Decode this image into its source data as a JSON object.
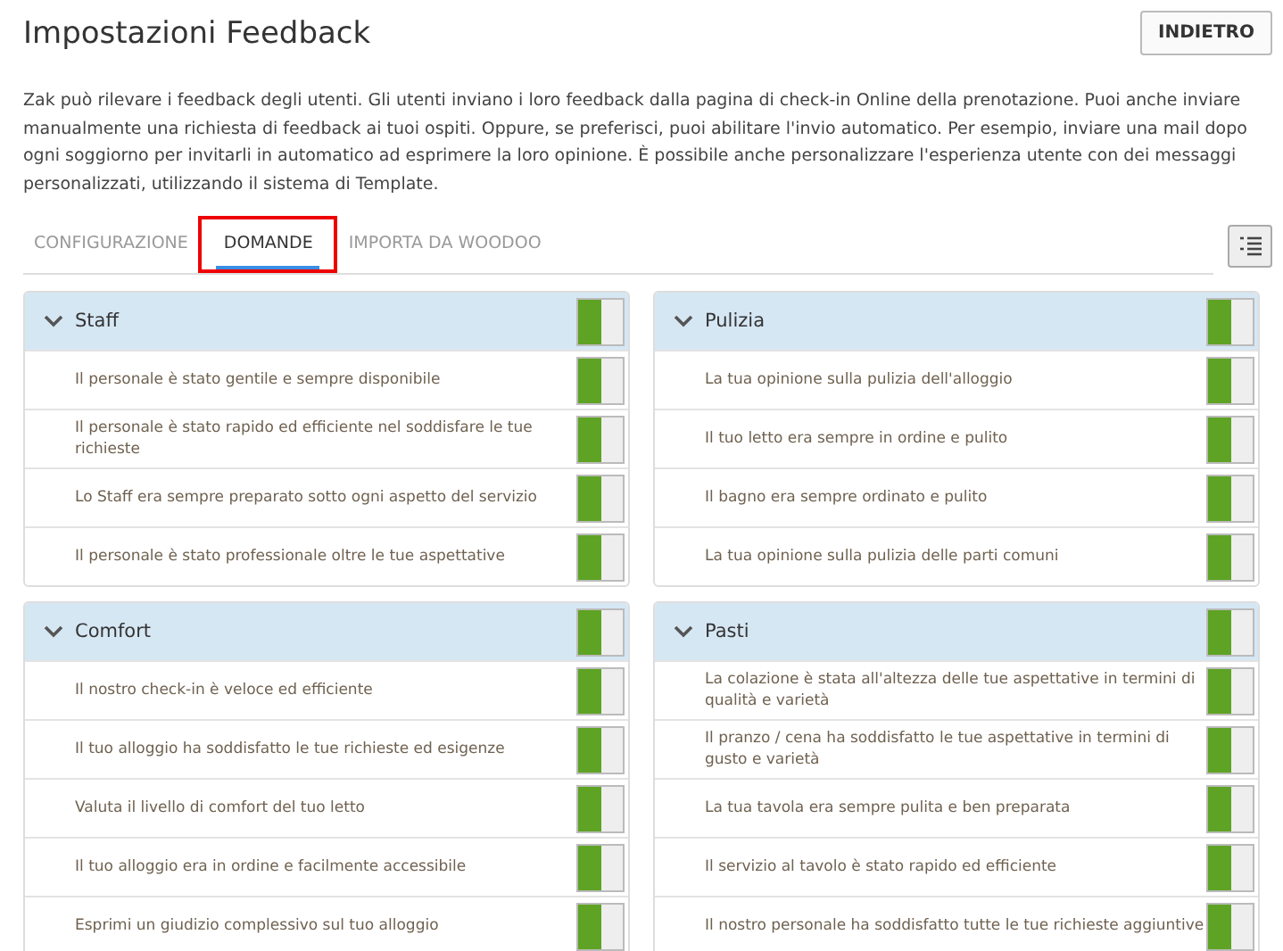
{
  "header": {
    "title": "Impostazioni Feedback",
    "back_button": "INDIETRO"
  },
  "description": "Zak può rilevare i feedback degli utenti. Gli utenti inviano i loro feedback dalla pagina di check-in Online della prenotazione. Puoi anche inviare manualmente una richiesta di feedback ai tuoi ospiti. Oppure, se preferisci, puoi abilitare l'invio automatico. Per esempio, inviare una mail dopo ogni soggiorno per invitarli in automatico ad esprimere la loro opinione. È possibile anche personalizzare l'esperienza utente con dei messaggi personalizzati, utilizzando il sistema di Template.",
  "tabs": [
    {
      "label": "CONFIGURAZIONE",
      "selected": false,
      "annotated": false
    },
    {
      "label": "DOMANDE",
      "selected": true,
      "annotated": true
    },
    {
      "label": "IMPORTA DA WOODOO",
      "selected": false,
      "annotated": false
    }
  ],
  "panels": [
    {
      "title": "Staff",
      "expanded": true,
      "on": true,
      "questions": [
        {
          "text": "Il personale è stato gentile e sempre disponibile",
          "on": true
        },
        {
          "text": "Il personale è stato rapido ed efficiente nel soddisfare le tue richieste",
          "on": true
        },
        {
          "text": "Lo Staff era sempre preparato sotto ogni aspetto del servizio",
          "on": true
        },
        {
          "text": "Il personale è stato professionale oltre le tue aspettative",
          "on": true
        }
      ]
    },
    {
      "title": "Pulizia",
      "expanded": true,
      "on": true,
      "questions": [
        {
          "text": "La tua opinione sulla pulizia dell'alloggio",
          "on": true
        },
        {
          "text": "Il tuo letto era sempre in ordine e pulito",
          "on": true
        },
        {
          "text": "Il bagno era sempre ordinato e pulito",
          "on": true
        },
        {
          "text": "La tua opinione sulla pulizia delle parti comuni",
          "on": true
        }
      ]
    },
    {
      "title": "Comfort",
      "expanded": true,
      "on": true,
      "questions": [
        {
          "text": "Il nostro check-in è veloce ed efficiente",
          "on": true
        },
        {
          "text": "Il tuo alloggio ha soddisfatto le tue richieste ed esigenze",
          "on": true
        },
        {
          "text": "Valuta il livello di comfort del tuo letto",
          "on": true
        },
        {
          "text": "Il tuo alloggio era in ordine e facilmente accessibile",
          "on": true
        },
        {
          "text": "Esprimi un giudizio complessivo sul tuo alloggio",
          "on": true
        }
      ]
    },
    {
      "title": "Pasti",
      "expanded": true,
      "on": true,
      "questions": [
        {
          "text": "La colazione è stata all'altezza delle tue aspettative in termini di qualità e varietà",
          "on": true
        },
        {
          "text": "Il pranzo / cena ha soddisfatto le tue aspettative in termini di gusto e varietà",
          "on": true
        },
        {
          "text": "La tua tavola era sempre pulita e ben preparata",
          "on": true
        },
        {
          "text": "Il servizio al tavolo è stato rapido ed efficiente",
          "on": true
        },
        {
          "text": "Il nostro personale ha soddisfatto tutte le tue richieste aggiuntive",
          "on": true
        }
      ]
    }
  ]
}
